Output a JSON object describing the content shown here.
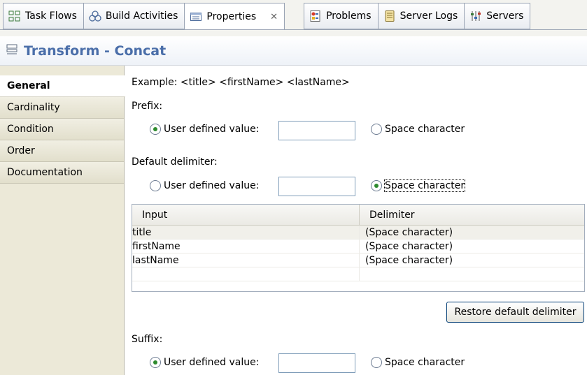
{
  "tabs": [
    {
      "label": "Task Flows",
      "icon": "task-flows-icon"
    },
    {
      "label": "Build Activities",
      "icon": "build-activities-icon"
    },
    {
      "label": "Properties",
      "icon": "properties-icon",
      "active": true,
      "close": "✕"
    },
    {
      "label": "Problems",
      "icon": "problems-icon"
    },
    {
      "label": "Server Logs",
      "icon": "server-logs-icon"
    },
    {
      "label": "Servers",
      "icon": "servers-icon"
    }
  ],
  "header": {
    "title": "Transform - Concat",
    "icon": "transform-icon"
  },
  "nav": {
    "items": [
      "General",
      "Cardinality",
      "Condition",
      "Order",
      "Documentation"
    ],
    "selected": "General"
  },
  "main": {
    "example": "Example:  <title> <firstName> <lastName>",
    "prefix": {
      "label": "Prefix:",
      "user_defined": "User defined value:",
      "space": "Space character",
      "selected": "user_defined",
      "value": ""
    },
    "default_delimiter": {
      "label": "Default delimiter:",
      "user_defined": "User defined value:",
      "space": "Space character",
      "selected": "space",
      "value": ""
    },
    "table": {
      "columns": [
        "Input",
        "Delimiter"
      ],
      "rows": [
        {
          "input": "title",
          "delimiter": "(Space character)"
        },
        {
          "input": "firstName",
          "delimiter": "(Space character)"
        },
        {
          "input": "lastName",
          "delimiter": "(Space character)"
        }
      ]
    },
    "restore_button": "Restore default delimiter",
    "suffix": {
      "label": "Suffix:",
      "user_defined": "User defined value:",
      "space": "Space character",
      "selected": "user_defined",
      "value": ""
    }
  },
  "colors": {
    "title": "#4a6ea9",
    "radio_dot": "#2e8b2e",
    "nav_bg": "#ece9d8"
  }
}
